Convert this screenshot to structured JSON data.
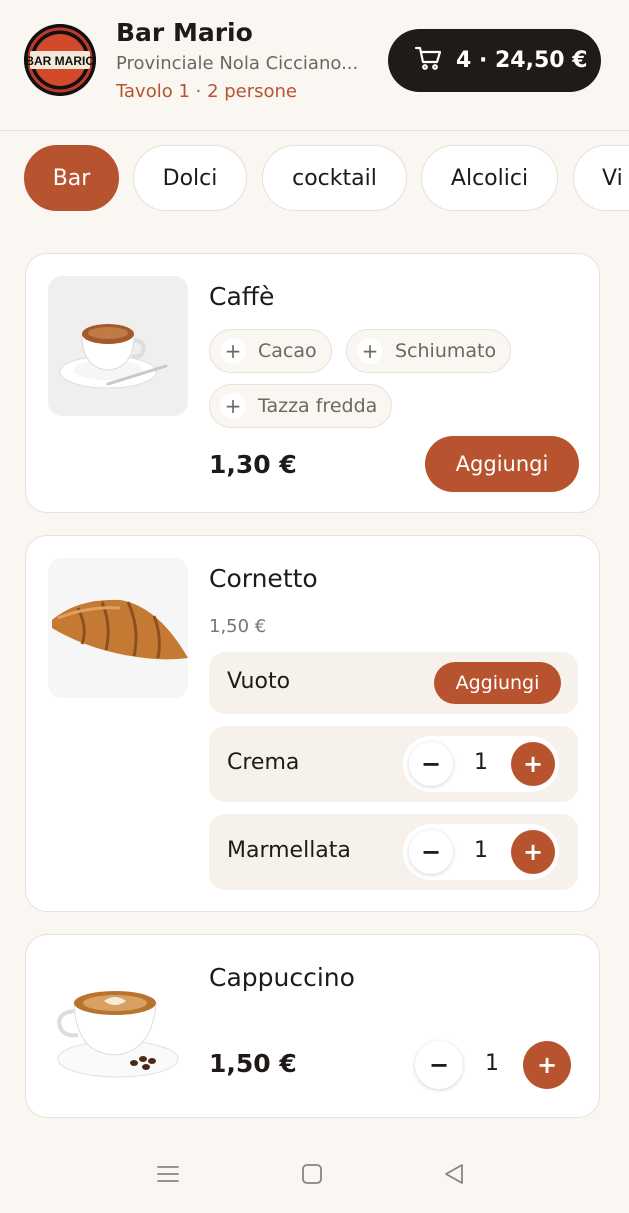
{
  "header": {
    "venue_name": "Bar Mario",
    "logo_text": "BAR MARIO",
    "address": "Provinciale Nola Cicciano...",
    "table_info": "Tavolo 1 · 2 persone",
    "cart_summary": "4 · 24,50 €"
  },
  "tabs": [
    "Bar",
    "Dolci",
    "cocktail",
    "Alcolici",
    "Vi"
  ],
  "items": {
    "caffe": {
      "name": "Caffè",
      "options": [
        "Cacao",
        "Schiumato",
        "Tazza fredda"
      ],
      "price": "1,30 €",
      "add_label": "Aggiungi"
    },
    "cornetto": {
      "name": "Cornetto",
      "price": "1,50 €",
      "variants": [
        {
          "label": "Vuoto",
          "add_label": "Aggiungi"
        },
        {
          "label": "Crema",
          "qty": "1"
        },
        {
          "label": "Marmellata",
          "qty": "1"
        }
      ]
    },
    "cappuccino": {
      "name": "Cappuccino",
      "price": "1,50 €",
      "qty": "1"
    }
  },
  "stepper": {
    "minus": "−",
    "plus": "+"
  },
  "chip_plus": "+",
  "colors": {
    "accent": "#b8532f",
    "dark": "#1e1b19",
    "background": "#faf6f1"
  },
  "icons": [
    "cart-icon",
    "menu-icon",
    "home-square-icon",
    "back-triangle-icon"
  ]
}
